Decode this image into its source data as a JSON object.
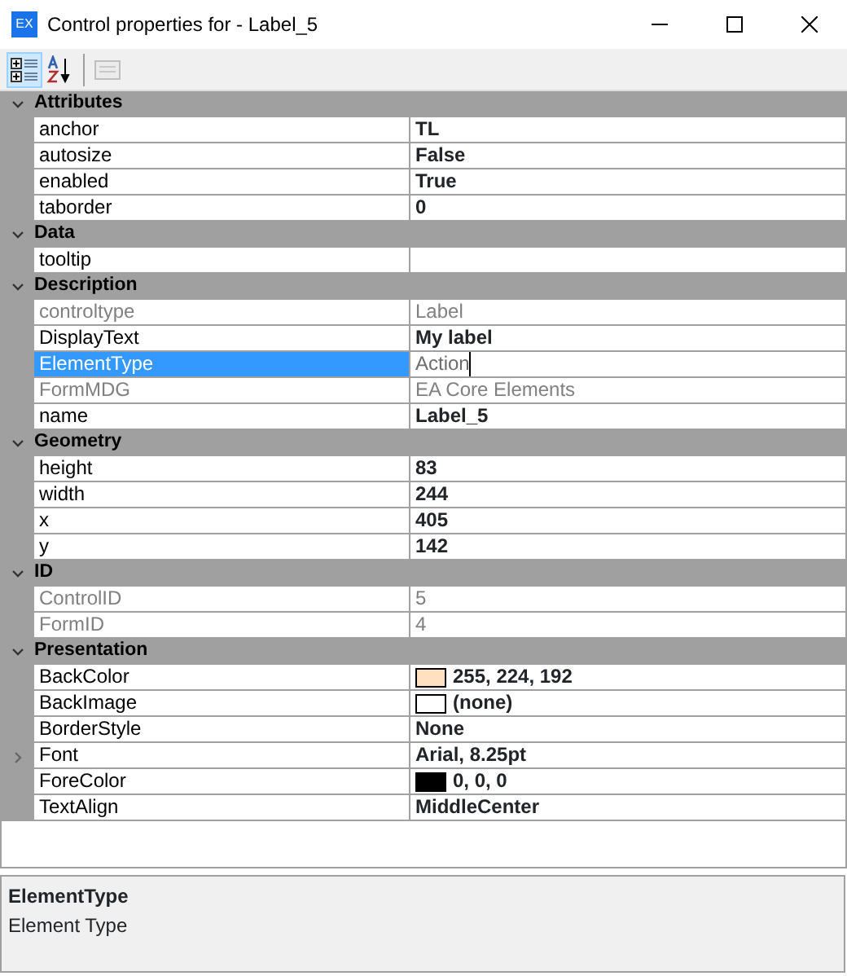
{
  "window": {
    "app_icon": "EX",
    "title": "Control properties for  - Label_5"
  },
  "toolbar": [
    {
      "kind": "categorized",
      "selected": true,
      "disabled": false
    },
    {
      "kind": "alphabetical",
      "selected": false,
      "disabled": false
    },
    {
      "kind": "pages",
      "selected": false,
      "disabled": true
    }
  ],
  "categories": [
    {
      "name": "Attributes",
      "expanded": true,
      "properties": [
        {
          "name": "anchor",
          "value": "TL",
          "modified": true,
          "disabled": false,
          "selected": false
        },
        {
          "name": "autosize",
          "value": "False",
          "modified": true,
          "disabled": false,
          "selected": false
        },
        {
          "name": "enabled",
          "value": "True",
          "modified": true,
          "disabled": false,
          "selected": false
        },
        {
          "name": "taborder",
          "value": "0",
          "modified": true,
          "disabled": false,
          "selected": false
        }
      ]
    },
    {
      "name": "Data",
      "expanded": true,
      "properties": [
        {
          "name": "tooltip",
          "disabled": false,
          "selected": false
        }
      ]
    },
    {
      "name": "Description",
      "expanded": true,
      "properties": [
        {
          "name": "controltype",
          "value": "Label",
          "modified": false,
          "disabled": true,
          "selected": false
        },
        {
          "name": "DisplayText",
          "value": "My label",
          "modified": true,
          "disabled": false,
          "selected": false
        },
        {
          "name": "ElementType",
          "value": "Action",
          "modified": false,
          "disabled": false,
          "selected": true
        },
        {
          "name": "FormMDG",
          "value": "EA Core Elements",
          "modified": false,
          "disabled": true,
          "selected": false
        },
        {
          "name": "name",
          "value": "Label_5",
          "modified": true,
          "disabled": false,
          "selected": false
        }
      ]
    },
    {
      "name": "Geometry",
      "expanded": true,
      "properties": [
        {
          "name": "height",
          "value": "83",
          "modified": true,
          "disabled": false,
          "selected": false
        },
        {
          "name": "width",
          "value": "244",
          "modified": true,
          "disabled": false,
          "selected": false
        },
        {
          "name": "x",
          "value": "405",
          "modified": true,
          "disabled": false,
          "selected": false
        },
        {
          "name": "y",
          "value": "142",
          "modified": true,
          "disabled": false,
          "selected": false
        }
      ]
    },
    {
      "name": "ID",
      "expanded": true,
      "properties": [
        {
          "name": "ControlID",
          "value": "5",
          "modified": false,
          "disabled": true,
          "selected": false
        },
        {
          "name": "FormID",
          "value": "4",
          "modified": false,
          "disabled": true,
          "selected": false
        }
      ]
    },
    {
      "name": "Presentation",
      "expanded": true,
      "properties": [
        {
          "name": "BackColor",
          "value": "255, 224, 192",
          "color": "#ffe0c0",
          "modified": true,
          "disabled": false,
          "selected": false
        },
        {
          "name": "BackImage",
          "value": "(none)",
          "color": "#ffffff",
          "modified": true,
          "disabled": false,
          "selected": false
        },
        {
          "name": "BorderStyle",
          "value": "None",
          "modified": true,
          "disabled": false,
          "selected": false
        },
        {
          "name": "Font",
          "value": "Arial, 8.25pt",
          "modified": true,
          "disabled": false,
          "selected": false,
          "expanded": false
        },
        {
          "name": "ForeColor",
          "value": "0, 0, 0",
          "color": "#000000",
          "modified": true,
          "disabled": false,
          "selected": false
        },
        {
          "name": "TextAlign",
          "value": "MiddleCenter",
          "modified": true,
          "disabled": false,
          "selected": false
        }
      ]
    }
  ],
  "description": {
    "title": "ElementType",
    "text": "Element Type"
  }
}
